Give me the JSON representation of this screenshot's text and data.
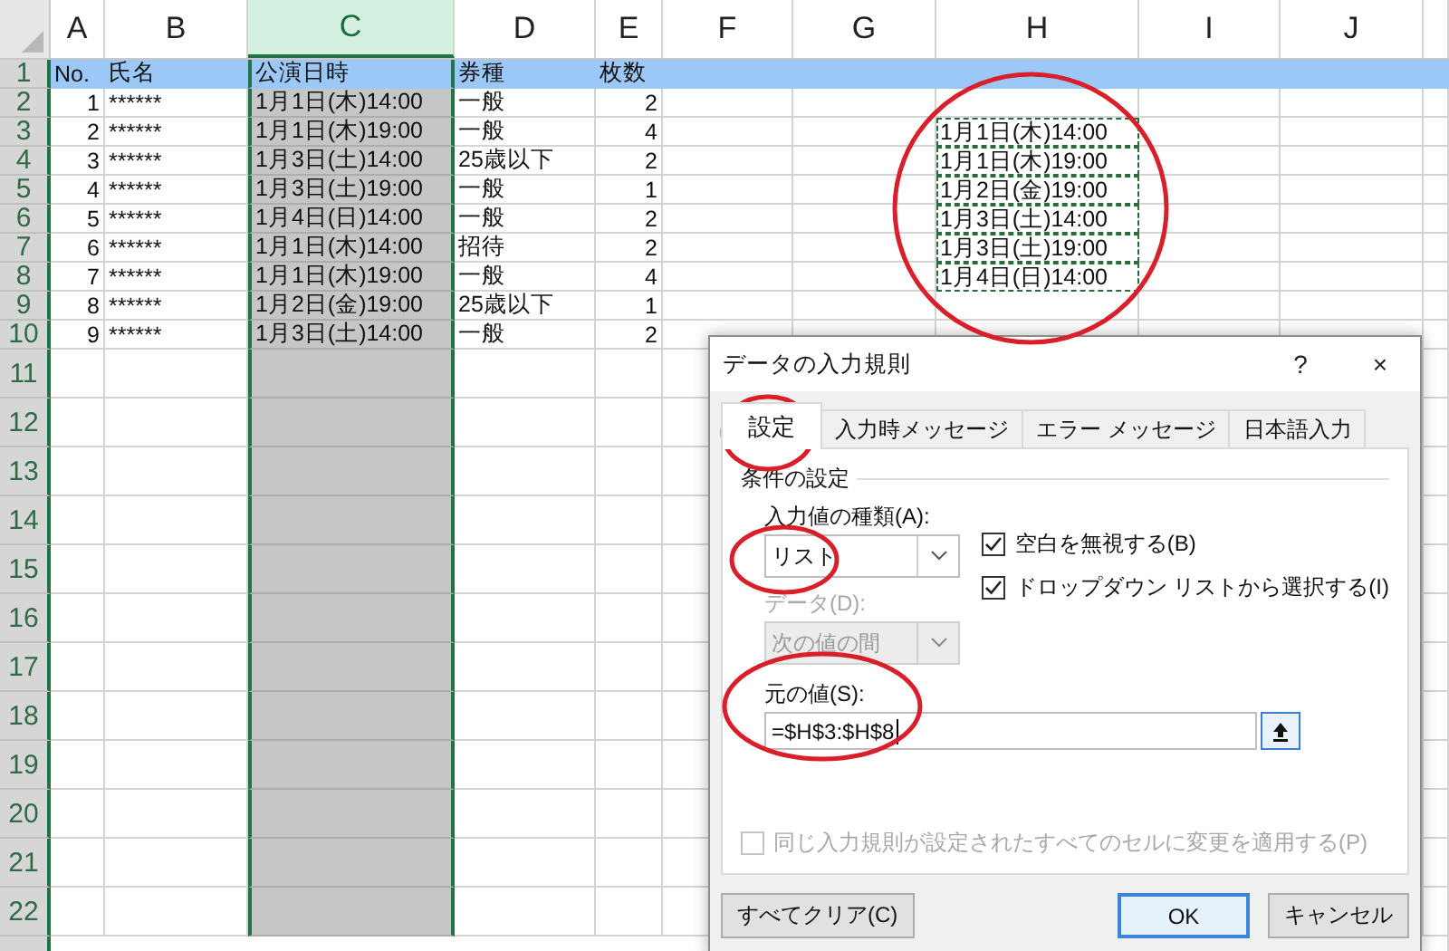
{
  "sheet": {
    "columns": [
      {
        "label": "A",
        "selected": false
      },
      {
        "label": "B",
        "selected": false
      },
      {
        "label": "C",
        "selected": true
      },
      {
        "label": "D",
        "selected": false
      },
      {
        "label": "E",
        "selected": false
      },
      {
        "label": "F",
        "selected": false
      },
      {
        "label": "G",
        "selected": false
      },
      {
        "label": "H",
        "selected": false
      },
      {
        "label": "I",
        "selected": false
      },
      {
        "label": "J",
        "selected": false
      }
    ],
    "rows": [
      {
        "label": "1",
        "kind": "header",
        "cells": [
          {
            "text": "No.",
            "kind": "text"
          },
          {
            "text": "氏名",
            "kind": "text"
          },
          {
            "text": "公演日時",
            "kind": "text"
          },
          {
            "text": "券種",
            "kind": "text"
          },
          {
            "text": "枚数",
            "kind": "text"
          }
        ]
      },
      {
        "label": "2",
        "kind": "data",
        "cells": [
          {
            "text": "1",
            "kind": "number"
          },
          {
            "text": "******",
            "kind": "text"
          },
          {
            "text": "1月1日(木)14:00",
            "kind": "text"
          },
          {
            "text": "一般",
            "kind": "text"
          },
          {
            "text": "2",
            "kind": "number"
          }
        ]
      },
      {
        "label": "3",
        "kind": "data",
        "cells": [
          {
            "text": "2",
            "kind": "number"
          },
          {
            "text": "******",
            "kind": "text"
          },
          {
            "text": "1月1日(木)19:00",
            "kind": "text"
          },
          {
            "text": "一般",
            "kind": "text"
          },
          {
            "text": "4",
            "kind": "number"
          }
        ],
        "list_source": "1月1日(木)14:00"
      },
      {
        "label": "4",
        "kind": "data",
        "cells": [
          {
            "text": "3",
            "kind": "number"
          },
          {
            "text": "******",
            "kind": "text"
          },
          {
            "text": "1月3日(土)14:00",
            "kind": "text"
          },
          {
            "text": "25歳以下",
            "kind": "text"
          },
          {
            "text": "2",
            "kind": "number"
          }
        ],
        "list_source": "1月1日(木)19:00"
      },
      {
        "label": "5",
        "kind": "data",
        "cells": [
          {
            "text": "4",
            "kind": "number"
          },
          {
            "text": "******",
            "kind": "text"
          },
          {
            "text": "1月3日(土)19:00",
            "kind": "text"
          },
          {
            "text": "一般",
            "kind": "text"
          },
          {
            "text": "1",
            "kind": "number"
          }
        ],
        "list_source": "1月2日(金)19:00"
      },
      {
        "label": "6",
        "kind": "data",
        "cells": [
          {
            "text": "5",
            "kind": "number"
          },
          {
            "text": "******",
            "kind": "text"
          },
          {
            "text": "1月4日(日)14:00",
            "kind": "text"
          },
          {
            "text": "一般",
            "kind": "text"
          },
          {
            "text": "2",
            "kind": "number"
          }
        ],
        "list_source": "1月3日(土)14:00"
      },
      {
        "label": "7",
        "kind": "data",
        "cells": [
          {
            "text": "6",
            "kind": "number"
          },
          {
            "text": "******",
            "kind": "text"
          },
          {
            "text": "1月1日(木)14:00",
            "kind": "text"
          },
          {
            "text": "招待",
            "kind": "text"
          },
          {
            "text": "2",
            "kind": "number"
          }
        ],
        "list_source": "1月3日(土)19:00"
      },
      {
        "label": "8",
        "kind": "data",
        "cells": [
          {
            "text": "7",
            "kind": "number"
          },
          {
            "text": "******",
            "kind": "text"
          },
          {
            "text": "1月1日(木)19:00",
            "kind": "text"
          },
          {
            "text": "一般",
            "kind": "text"
          },
          {
            "text": "4",
            "kind": "number"
          }
        ],
        "list_source": "1月4日(日)14:00"
      },
      {
        "label": "9",
        "kind": "data",
        "cells": [
          {
            "text": "8",
            "kind": "number"
          },
          {
            "text": "******",
            "kind": "text"
          },
          {
            "text": "1月2日(金)19:00",
            "kind": "text"
          },
          {
            "text": "25歳以下",
            "kind": "text"
          },
          {
            "text": "1",
            "kind": "number"
          }
        ]
      },
      {
        "label": "10",
        "kind": "data",
        "cells": [
          {
            "text": "9",
            "kind": "number"
          },
          {
            "text": "******",
            "kind": "text"
          },
          {
            "text": "1月3日(土)14:00",
            "kind": "text"
          },
          {
            "text": "一般",
            "kind": "text"
          },
          {
            "text": "2",
            "kind": "number"
          }
        ]
      },
      {
        "label": "11",
        "kind": "empty"
      },
      {
        "label": "12",
        "kind": "empty"
      },
      {
        "label": "13",
        "kind": "empty"
      },
      {
        "label": "14",
        "kind": "empty"
      },
      {
        "label": "15",
        "kind": "empty"
      },
      {
        "label": "16",
        "kind": "empty"
      },
      {
        "label": "17",
        "kind": "empty"
      },
      {
        "label": "18",
        "kind": "empty"
      },
      {
        "label": "19",
        "kind": "empty"
      },
      {
        "label": "20",
        "kind": "empty"
      },
      {
        "label": "21",
        "kind": "empty"
      },
      {
        "label": "22",
        "kind": "empty"
      }
    ]
  },
  "dialog": {
    "title": "データの入力規則",
    "help_button": "?",
    "close_button": "×",
    "tabs": [
      {
        "label": "設定",
        "selected": true
      },
      {
        "label": "入力時メッセージ",
        "selected": false
      },
      {
        "label": "エラー メッセージ",
        "selected": false
      },
      {
        "label": "日本語入力",
        "selected": false
      }
    ],
    "group_label": "条件の設定",
    "type_label": "入力値の種類(A):",
    "type_value": "リスト",
    "data_label": "データ(D):",
    "data_value": "次の値の間",
    "data_disabled": true,
    "options": [
      {
        "label": "空白を無視する(B)",
        "checked": true
      },
      {
        "label": "ドロップダウン リストから選択する(I)",
        "checked": true
      }
    ],
    "source_label": "元の値(S):",
    "source_value": "=$H$3:$H$8",
    "apply_all": {
      "label": "同じ入力規則が設定されたすべてのセルに変更を適用する(P)",
      "checked": false,
      "disabled": true
    },
    "buttons": [
      {
        "label": "すべてクリア(C)",
        "default": false
      },
      {
        "label": "OK",
        "default": true
      },
      {
        "label": "キャンセル",
        "default": false
      }
    ]
  }
}
